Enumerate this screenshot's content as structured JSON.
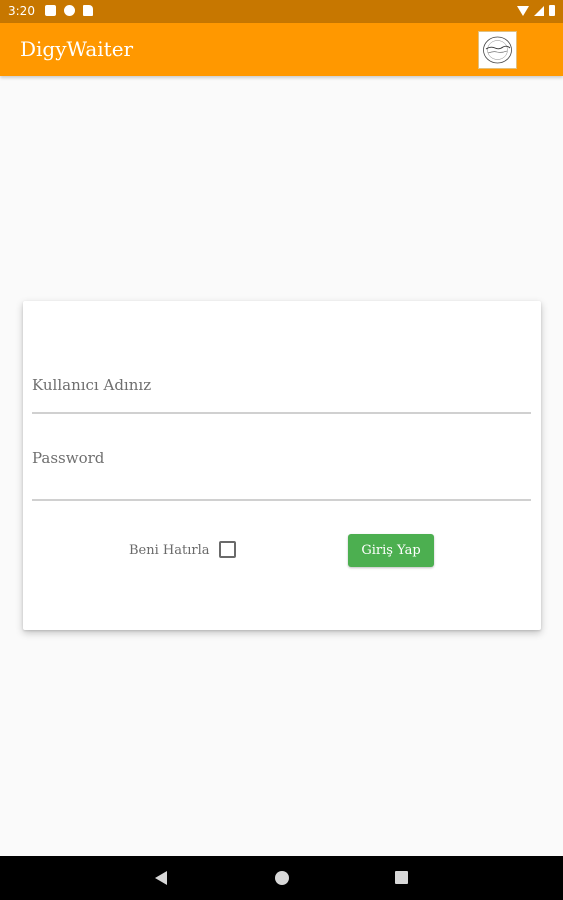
{
  "status_bar": {
    "time": "3:20",
    "left_icons": [
      "notification-square-icon",
      "circle-app-icon",
      "sd-card-icon"
    ],
    "right_icons": [
      "wifi-icon",
      "signal-icon",
      "battery-icon"
    ]
  },
  "app_bar": {
    "title": "DigyWaiter",
    "logo": "app-logo",
    "background_color": "#ff9800"
  },
  "login_form": {
    "username": {
      "label": "Kullanıcı Adınız",
      "value": ""
    },
    "password": {
      "label": "Password",
      "value": ""
    },
    "remember_me": {
      "label": "Beni Hatırla",
      "checked": false
    },
    "submit_button": {
      "label": "Giriş Yap",
      "color": "#4caf50"
    }
  },
  "nav_bar": {
    "buttons": [
      "back-icon",
      "home-icon",
      "recents-icon"
    ]
  }
}
